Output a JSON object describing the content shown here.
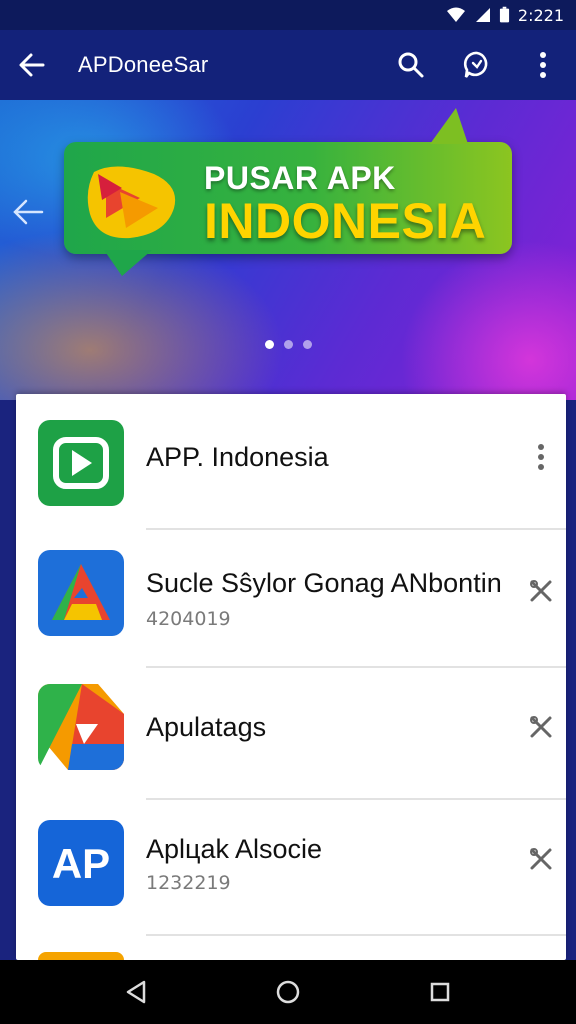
{
  "status_bar": {
    "time": "2:221"
  },
  "app_bar": {
    "title": "APDoneeSar"
  },
  "hero": {
    "line1": "PUSAR APK",
    "line2": "INDONESIA",
    "dots": 3,
    "active_dot": 0
  },
  "apps": [
    {
      "name": "APP. Indonesia",
      "meta": "",
      "trailing": "more-vert-icon"
    },
    {
      "name": "Sucle Sŝylor Gonag ANbontin",
      "meta": "4204019",
      "trailing": "tools-icon"
    },
    {
      "name": "Apulatags",
      "meta": "",
      "trailing": "tools-icon"
    },
    {
      "name": "Aplцak Alsocie",
      "meta": "1232219",
      "trailing": "tools-icon"
    }
  ],
  "colors": {
    "app_bar": "#13227a",
    "status_bar": "#0d1a5c",
    "hero_yellow": "#ffd400",
    "green": "#1fa64a",
    "blue": "#1e6fd9"
  }
}
